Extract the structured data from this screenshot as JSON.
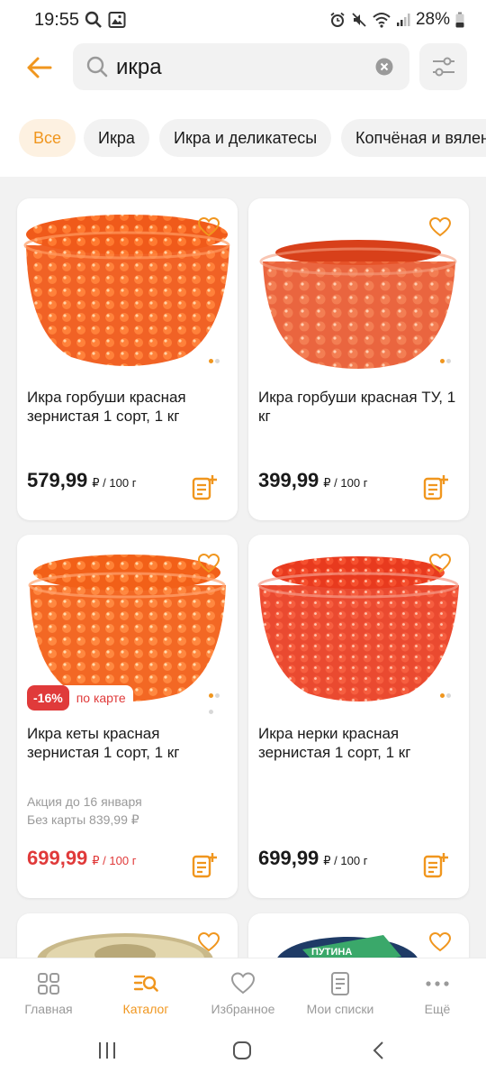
{
  "status_bar": {
    "time": "19:55",
    "battery": "28%"
  },
  "search": {
    "query": "икра"
  },
  "chips": [
    {
      "label": "Все",
      "active": true
    },
    {
      "label": "Икра",
      "active": false
    },
    {
      "label": "Икра и деликатесы",
      "active": false
    },
    {
      "label": "Копчёная и вяленая",
      "active": false
    }
  ],
  "products": [
    {
      "title": "Икра горбуши красная зернистая 1 сорт, 1 кг",
      "price": "579,99",
      "unit": "₽ / 100 г"
    },
    {
      "title": "Икра горбуши красная ТУ, 1 кг",
      "price": "399,99",
      "unit": "₽ / 100 г"
    },
    {
      "title": "Икра кеты красная зернистая 1 сорт, 1 кг",
      "price": "699,99",
      "unit": "₽ / 100 г",
      "discount": "-16%",
      "discount_label": "по карте",
      "promo_line1": "Акция до 16 января",
      "promo_line2": "Без карты 839,99 ₽"
    },
    {
      "title": "Икра нерки красная зернистая 1 сорт, 1 кг",
      "price": "699,99",
      "unit": "₽ / 100 г"
    },
    {
      "brand": "ПУТИНА"
    }
  ],
  "nav": [
    {
      "label": "Главная",
      "icon": "grid-icon"
    },
    {
      "label": "Каталог",
      "icon": "catalog-search-icon",
      "active": true
    },
    {
      "label": "Избранное",
      "icon": "heart-icon"
    },
    {
      "label": "Мои списки",
      "icon": "list-icon"
    },
    {
      "label": "Ещё",
      "icon": "more-icon"
    }
  ],
  "colors": {
    "accent": "#f0961e",
    "promo": "#e03a3a"
  }
}
